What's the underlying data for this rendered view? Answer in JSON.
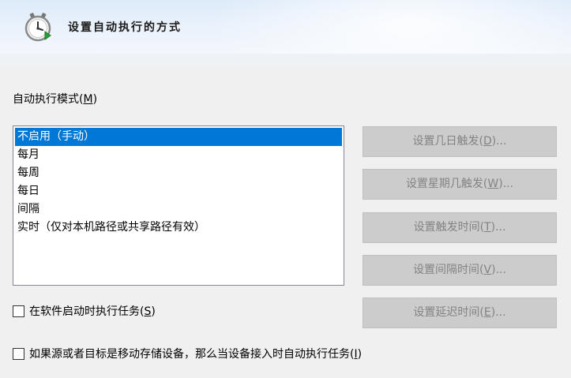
{
  "header": {
    "title": "设置自动执行的方式",
    "icon": "clock-arrow-icon"
  },
  "mode_label": {
    "text": "自动执行模式(",
    "key": "M",
    "suffix": ")"
  },
  "mode_list": {
    "selected_index": 0,
    "items": [
      "不启用（手动）",
      "每月",
      "每周",
      "每日",
      "间隔",
      "实时（仅对本机路径或共享路径有效）"
    ]
  },
  "buttons": [
    {
      "text": "设置几日触发(",
      "key": "D",
      "suffix": ")...",
      "enabled": false
    },
    {
      "text": "设置星期几触发(",
      "key": "W",
      "suffix": ")...",
      "enabled": false
    },
    {
      "text": "设置触发时间(",
      "key": "T",
      "suffix": ")...",
      "enabled": false
    },
    {
      "text": "设置间隔时间(",
      "key": "V",
      "suffix": ")...",
      "enabled": false
    },
    {
      "text": "设置延迟时间(",
      "key": "E",
      "suffix": ")...",
      "enabled": false
    }
  ],
  "checkboxes": [
    {
      "text": "在软件启动时执行任务(",
      "key": "S",
      "suffix": ")",
      "checked": false
    },
    {
      "text": "如果源或者目标是移动存储设备，那么当设备接入时自动执行任务(",
      "key": "I",
      "suffix": ")",
      "checked": false
    }
  ],
  "colors": {
    "selection": "#0078d7",
    "disabled_button_bg": "#cccccc",
    "disabled_button_text": "#838383",
    "window_bg": "#f0f0f0"
  }
}
